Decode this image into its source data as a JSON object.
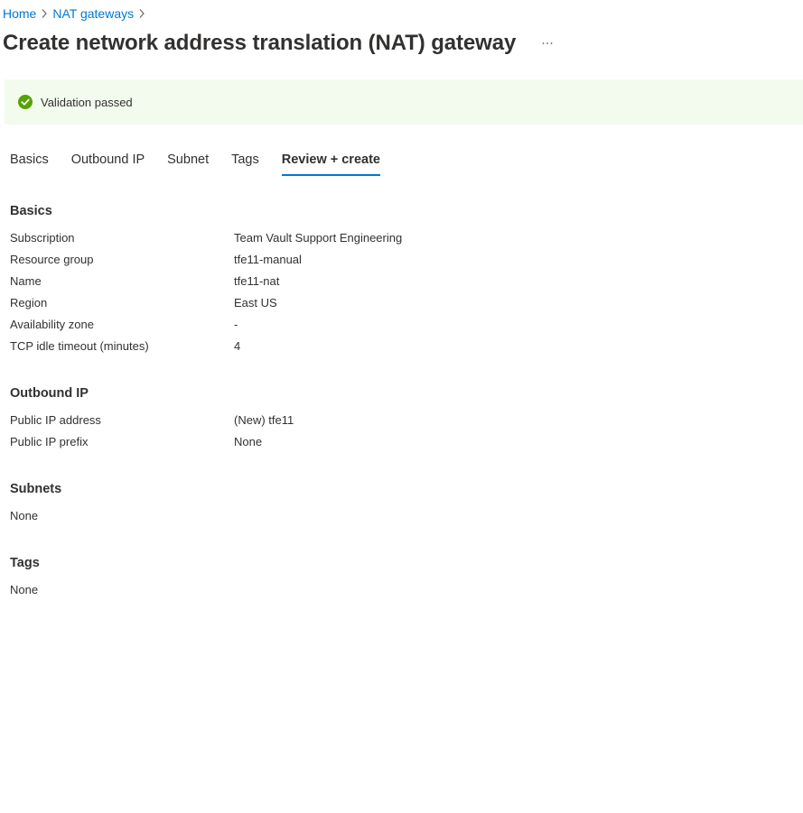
{
  "breadcrumb": [
    {
      "label": "Home"
    },
    {
      "label": "NAT gateways"
    }
  ],
  "page_title": "Create network address translation (NAT) gateway",
  "more_icon": "more-ellipsis-icon",
  "banner": {
    "icon": "check-circle-icon",
    "text": "Validation passed",
    "color": "#57a300",
    "background": "#f3fbee"
  },
  "tabs": [
    {
      "label": "Basics",
      "active": false
    },
    {
      "label": "Outbound IP",
      "active": false
    },
    {
      "label": "Subnet",
      "active": false
    },
    {
      "label": "Tags",
      "active": false
    },
    {
      "label": "Review + create",
      "active": true
    }
  ],
  "sections": {
    "basics": {
      "title": "Basics",
      "rows": [
        {
          "key": "Subscription",
          "value": "Team Vault Support Engineering"
        },
        {
          "key": "Resource group",
          "value": "tfe11-manual"
        },
        {
          "key": "Name",
          "value": "tfe11-nat"
        },
        {
          "key": "Region",
          "value": "East US"
        },
        {
          "key": "Availability zone",
          "value": "-"
        },
        {
          "key": "TCP idle timeout (minutes)",
          "value": "4"
        }
      ]
    },
    "outbound_ip": {
      "title": "Outbound IP",
      "rows": [
        {
          "key": "Public IP address",
          "value": "(New) tfe11"
        },
        {
          "key": "Public IP prefix",
          "value": "None"
        }
      ]
    },
    "subnets": {
      "title": "Subnets",
      "value": "None"
    },
    "tags": {
      "title": "Tags",
      "value": "None"
    }
  },
  "accent_color": "#0078d4"
}
